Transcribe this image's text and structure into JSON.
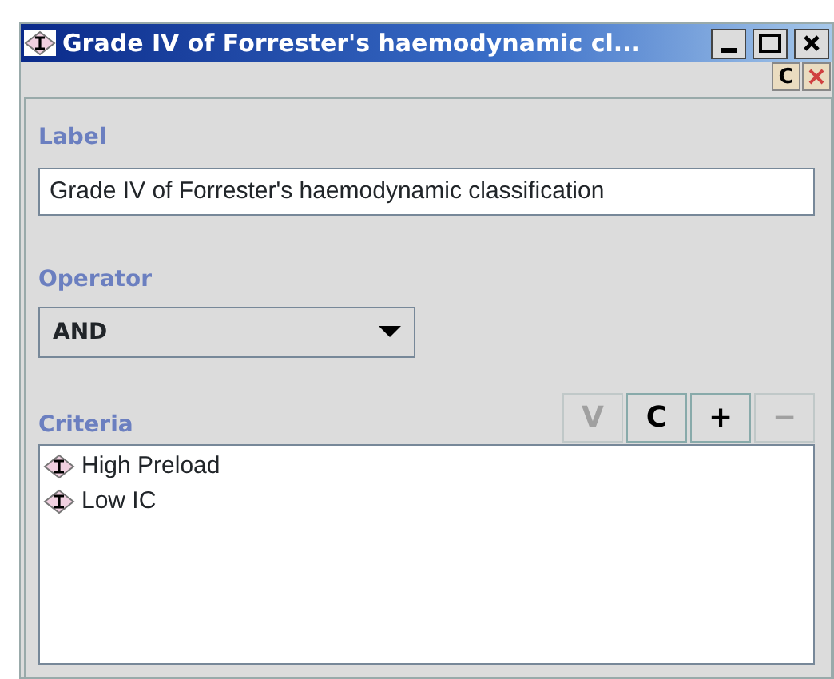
{
  "window": {
    "title": "Grade IV of Forrester's haemodynamic cl..."
  },
  "toolbar": {
    "buttons": [
      {
        "kind": "text",
        "label": "C"
      },
      {
        "kind": "delete"
      }
    ]
  },
  "label_field": {
    "heading": "Label",
    "value": "Grade IV of Forrester's haemodynamic classification"
  },
  "operator": {
    "heading": "Operator",
    "value": "AND"
  },
  "criteria": {
    "heading": "Criteria",
    "buttons": [
      {
        "label": "V",
        "disabled": true
      },
      {
        "label": "C",
        "disabled": false
      },
      {
        "label": "+",
        "disabled": false
      },
      {
        "label": "−",
        "disabled": true
      }
    ],
    "items": [
      {
        "label": "High Preload"
      },
      {
        "label": "Low IC"
      }
    ]
  }
}
